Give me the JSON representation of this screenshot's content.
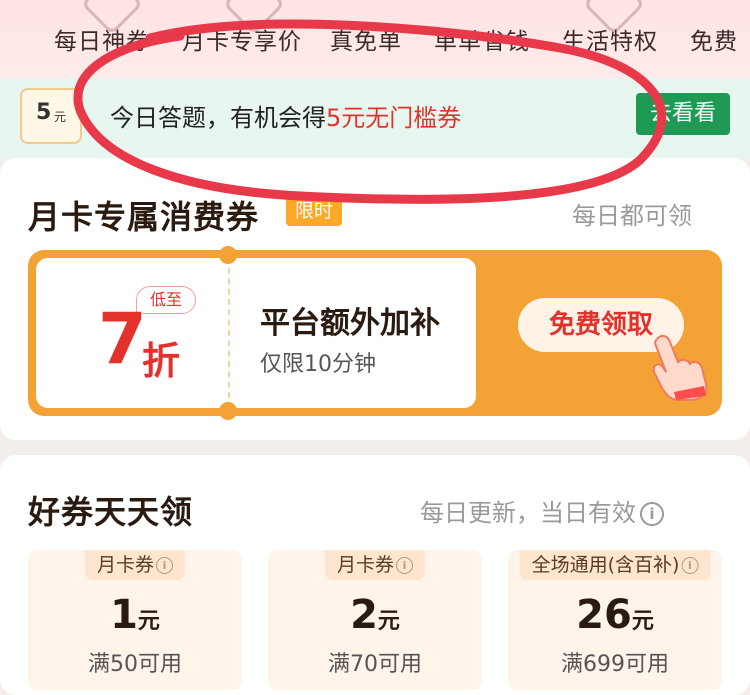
{
  "topnav": {
    "categories": [
      "每日神券",
      "月卡专享价",
      "真免单",
      "单单省钱",
      "生活特权",
      "免费"
    ]
  },
  "quiz_banner": {
    "badge_value": "5",
    "badge_unit": "元",
    "text_prefix": "今日答题，有机会得",
    "text_highlight": "5元无门槛券",
    "button_label": "去看看"
  },
  "monthly_section": {
    "title": "月卡专属消费券",
    "limited_tag": "限时",
    "right_text": "每日都可领",
    "coupon": {
      "discount_tag": "低至",
      "discount_value": "7",
      "discount_unit": "折",
      "title": "平台额外加补",
      "subtitle": "仅限10分钟",
      "claim_label": "免费领取"
    }
  },
  "daily_section": {
    "title": "好券天天领",
    "right_text": "每日更新，当日有效",
    "coupons": [
      {
        "tag": "月卡券",
        "value": "1",
        "unit": "元",
        "condition": "满50可用"
      },
      {
        "tag": "月卡券",
        "value": "2",
        "unit": "元",
        "condition": "满70可用"
      },
      {
        "tag": "全场通用(含百补)",
        "value": "26",
        "unit": "元",
        "condition": "满699可用"
      }
    ]
  },
  "colors": {
    "accent_red": "#e3312c",
    "accent_orange": "#f3a335",
    "accent_green": "#1e9a55"
  }
}
